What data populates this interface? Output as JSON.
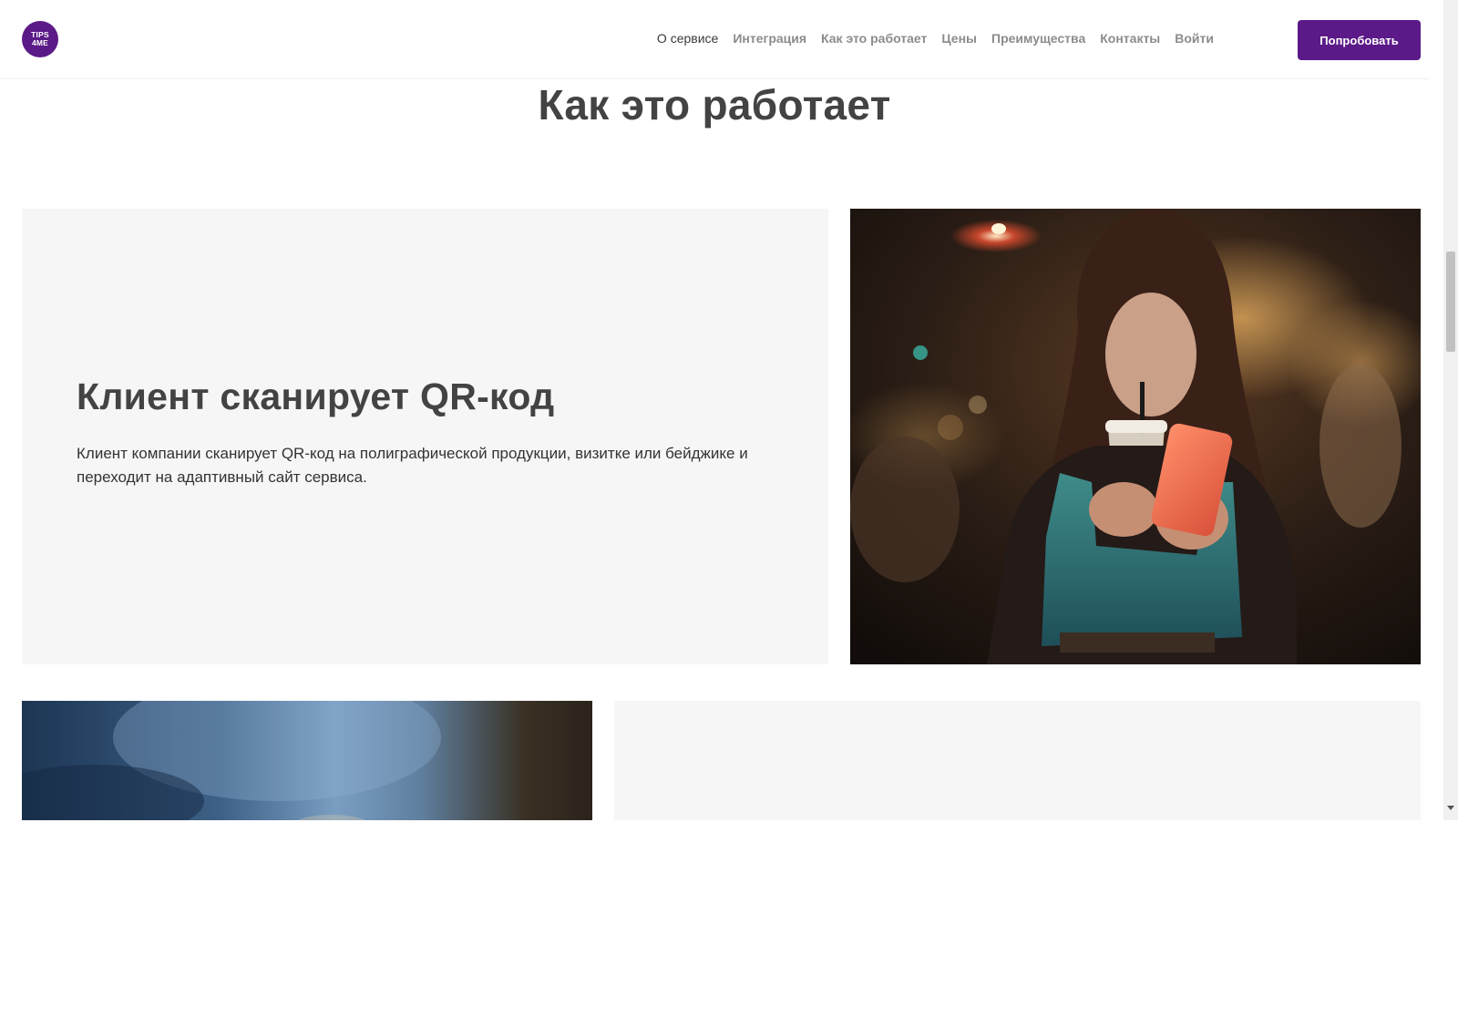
{
  "header": {
    "logo_line1": "TIPS",
    "logo_line2": "4ME",
    "nav": [
      {
        "label": "О сервисе",
        "active": true
      },
      {
        "label": "Интеграция"
      },
      {
        "label": "Как это работает"
      },
      {
        "label": "Цены"
      },
      {
        "label": "Преимущества"
      },
      {
        "label": "Контакты"
      },
      {
        "label": "Войти"
      }
    ],
    "cta_label": "Попробовать"
  },
  "section": {
    "title": "Как это работает"
  },
  "steps": [
    {
      "heading": "Клиент сканирует QR-код",
      "body": "Клиент компании сканирует QR-код на полиграфической продукции, визитке или бейджике и переходит на адаптивный сайт сервиса."
    }
  ],
  "colors": {
    "brand": "#5b1a87",
    "card_bg": "#f6f6f6",
    "text": "#434343"
  }
}
